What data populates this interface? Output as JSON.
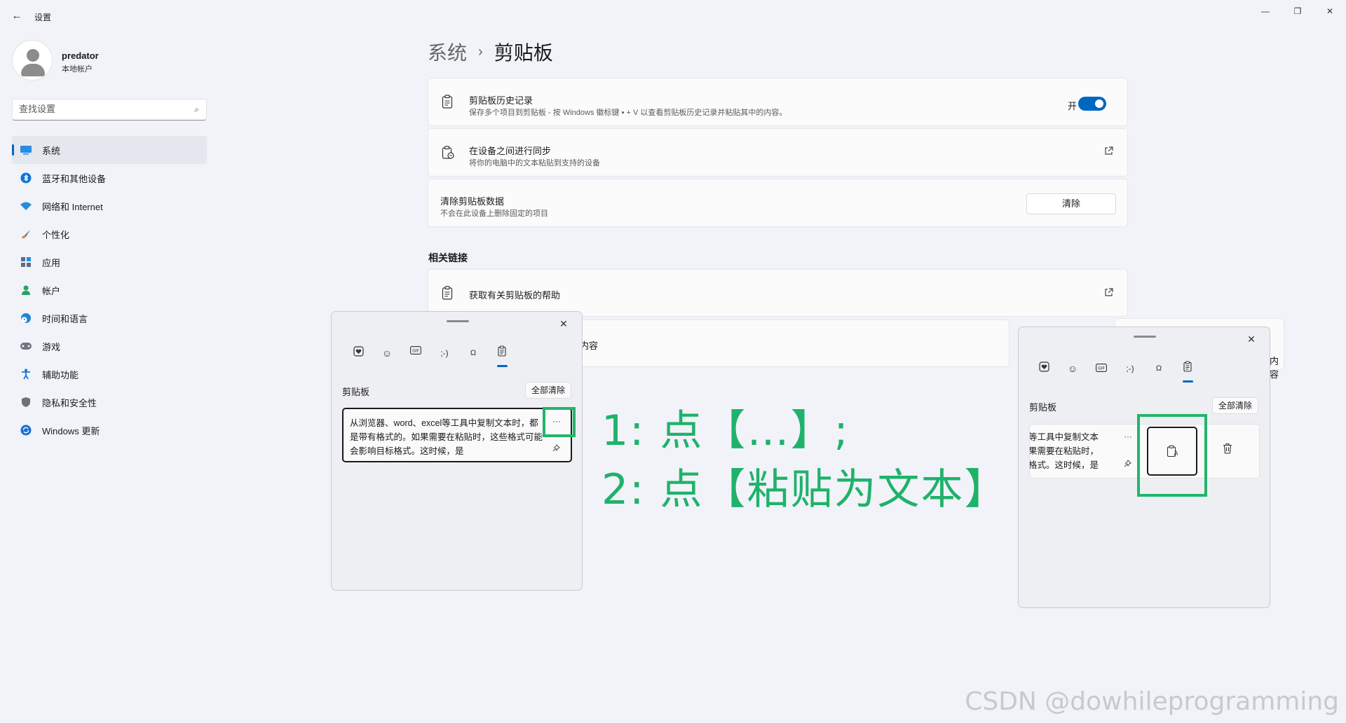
{
  "window": {
    "title": "设置",
    "back_icon": "←",
    "minimize_icon": "—",
    "maximize_icon": "❐",
    "close_icon": "✕"
  },
  "profile": {
    "name": "predator",
    "account_type": "本地帐户"
  },
  "search": {
    "placeholder": "查找设置",
    "icon": "⌕"
  },
  "nav": {
    "items": [
      {
        "label": "系统",
        "icon": "monitor-icon",
        "active": true,
        "color": "#0067c0"
      },
      {
        "label": "蓝牙和其他设备",
        "icon": "bluetooth-icon",
        "color": "#0a74d9"
      },
      {
        "label": "网络和 Internet",
        "icon": "wifi-icon",
        "color": "#2a8bd8"
      },
      {
        "label": "个性化",
        "icon": "brush-icon",
        "color": "#e8863a"
      },
      {
        "label": "应用",
        "icon": "apps-icon",
        "color": "#5a6c8c"
      },
      {
        "label": "帐户",
        "icon": "person-icon",
        "color": "#22a55e"
      },
      {
        "label": "时间和语言",
        "icon": "globe-clock-icon",
        "color": "#1f86d6"
      },
      {
        "label": "游戏",
        "icon": "gamepad-icon",
        "color": "#6e7684"
      },
      {
        "label": "辅助功能",
        "icon": "accessibility-icon",
        "color": "#1577d4"
      },
      {
        "label": "隐私和安全性",
        "icon": "shield-icon",
        "color": "#6c727c"
      },
      {
        "label": "Windows 更新",
        "icon": "update-icon",
        "color": "#1a6fd1"
      }
    ]
  },
  "breadcrumb": {
    "parent": "系统",
    "separator": "›",
    "current": "剪贴板"
  },
  "cards": {
    "history": {
      "title": "剪贴板历史记录",
      "subtitle": "保存多个项目到剪贴板 - 按 Windows 徽标键 ▪ + V 以查看剪贴板历史记录并粘贴其中的内容。",
      "toggle_label": "开",
      "toggle_on": true
    },
    "sync": {
      "title": "在设备之间进行同步",
      "subtitle": "将你的电脑中的文本粘贴到支持的设备"
    },
    "clear": {
      "title": "清除剪贴板数据",
      "subtitle": "不会在此设备上删除固定的项目",
      "button": "清除"
    }
  },
  "related": {
    "heading": "相关链接",
    "help": "获取有关剪贴板的帮助",
    "partial_text": "内容"
  },
  "panel_left": {
    "title": "剪贴板",
    "clear_all": "全部清除",
    "item_text": "从浏览器、word、excel等工具中复制文本时，都是带有格式的。如果需要在粘贴时，这些格式可能会影响目标格式。这时候，是",
    "more": "···",
    "pin_icon": "pin-icon"
  },
  "panel_right": {
    "title": "剪贴板",
    "clear_all": "全部清除",
    "item_text": "等工具中复制文本\n果需要在粘贴时，\n格式。这时候，是",
    "more": "···",
    "partial_text": "内容"
  },
  "annotation": {
    "line1": "1:  点【…】;",
    "line2": "2:  点【粘贴为文本】",
    "color": "#21b66a"
  },
  "watermark": "CSDN @dowhileprogramming"
}
